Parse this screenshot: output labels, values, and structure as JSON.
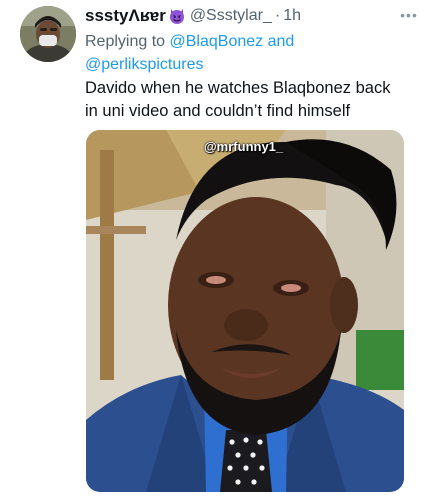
{
  "tweet": {
    "display_name": "ssstyɅʁɐr",
    "name_emoji": "smiling-face-with-horns-emoji",
    "handle": "@Ssstylar_",
    "separator": "·",
    "time": "1h",
    "more_label": "•••",
    "reply_prefix": "Replying to",
    "reply_mention_1": "@BlaqBonez",
    "reply_and": "and",
    "reply_mention_2": "@perlikspictures",
    "text_line_1": "Davido when he watches Blaqbonez back",
    "text_line_2": "in uni video and couldn’t find himself",
    "media_watermark": "@mrfunny1_"
  },
  "colors": {
    "text_primary": "#0f1419",
    "text_secondary": "#536471",
    "link": "#1d9bf0",
    "suit": "#2c4f8f",
    "shirt": "#2f6fcf"
  }
}
